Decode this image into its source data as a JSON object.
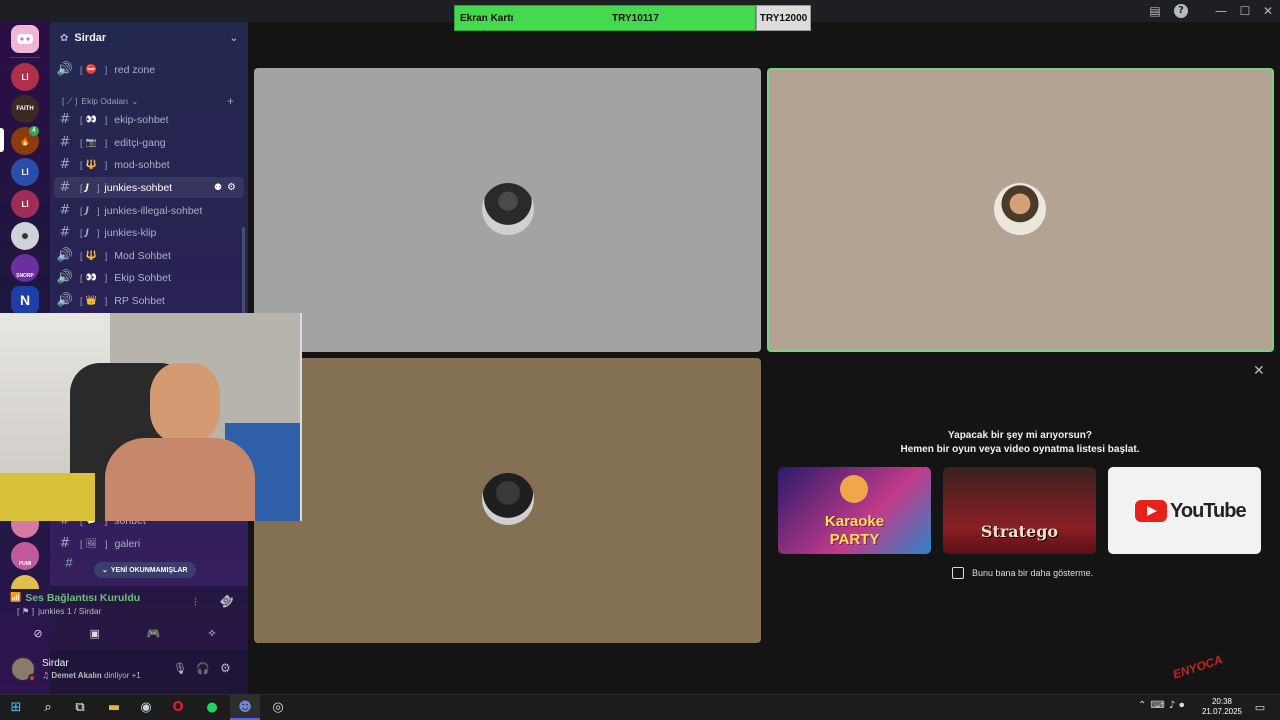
{
  "window": {
    "inbox_icon": "inbox-icon",
    "help_icon": "help-icon",
    "minimize_glyph": "—",
    "maximize_glyph": "☐",
    "close_glyph": "✕"
  },
  "donation": {
    "label": "Ekran Kartı",
    "current": "TRY10117",
    "goal": "TRY12000",
    "progress": 0.843,
    "color": "#45d94f"
  },
  "rail": {
    "servers": [
      {
        "name": "discord-home",
        "text": "",
        "bg": "#5865f2"
      },
      {
        "name": "server-li-1",
        "text": "Lİ",
        "bg": "#b0304a"
      },
      {
        "name": "server-faith",
        "text": "FAITH",
        "bg": "#3a2a22"
      },
      {
        "name": "server-fire",
        "text": "",
        "bg": "#8a3c10",
        "badge": "4"
      },
      {
        "name": "server-li-2",
        "text": "Lİ",
        "bg": "#2a4da8"
      },
      {
        "name": "server-li-3",
        "text": "Lİ",
        "bg": "#a02d55"
      },
      {
        "name": "server-wolf",
        "text": "",
        "bg": "#cfd2d8"
      },
      {
        "name": "server-snorp",
        "text": "SNORP",
        "bg": "#6a2fa0"
      },
      {
        "name": "server-n",
        "text": "N",
        "bg": "#1f3da6"
      },
      {
        "name": "server-pink",
        "text": "",
        "bg": "#d67aa2"
      },
      {
        "name": "server-purple",
        "text": "",
        "bg": "#8a4ab0"
      },
      {
        "name": "server-pumi",
        "text": "PUMI",
        "bg": "#c05a9a"
      }
    ]
  },
  "sidebar": {
    "server_name": "Sirdar",
    "category": "Ekip Odaları",
    "channels": [
      {
        "label": "red zone",
        "emoji": "⛔",
        "type": "voice"
      },
      {
        "label": "ekip-sohbet",
        "emoji": "👀",
        "type": "text"
      },
      {
        "label": "editçi-gang",
        "emoji": "📷",
        "type": "text"
      },
      {
        "label": "mod-sohbet",
        "emoji": "🔱",
        "type": "text"
      },
      {
        "label": "junkies-sohbet",
        "emoji": "J",
        "type": "text",
        "active": true
      },
      {
        "label": "junkies-illegal-sohbet",
        "emoji": "J",
        "type": "text"
      },
      {
        "label": "junkies-klip",
        "emoji": "J",
        "type": "text"
      },
      {
        "label": "Mod Sohbet",
        "emoji": "🔱",
        "type": "voice"
      },
      {
        "label": "Ekip Sohbet",
        "emoji": "👀",
        "type": "voice"
      },
      {
        "label": "RP Sohbet",
        "emoji": "👑",
        "type": "voice"
      },
      {
        "label": "sohbet",
        "emoji": "💬",
        "type": "text"
      },
      {
        "label": "galeri",
        "emoji": "🖼",
        "type": "text"
      }
    ],
    "unread_pill": "YENİ OKUNMAMIŞLAR",
    "voice": {
      "status": "Ses Bağlantısı Kuruldu",
      "channel": "junkies 1 / Sirdar"
    },
    "user": {
      "name": "Sirdar",
      "listening_name": "Demet Akalın",
      "listening_suffix": " dinliyor +1"
    }
  },
  "activity": {
    "title": "Yapacak bir şey mi arıyorsun?",
    "subtitle": "Hemen bir oyun veya video oynatma listesi başlat.",
    "cards": [
      {
        "name": "karaoke",
        "line1": "Karaoke",
        "line2": "PARTY"
      },
      {
        "name": "stratego",
        "line1": "Stratego"
      },
      {
        "name": "youtube",
        "line1": "YouTube"
      }
    ],
    "checkbox_label": "Bunu bana bir daha gösterme."
  },
  "tiles": {
    "tile1_bg": "#a3a3a3",
    "tile2_bg": "#b3a392",
    "tile3_bg": "#847154",
    "tile2_border": "#7ad082"
  },
  "taskbar": {
    "time": "20:38",
    "date": "21.07.2025"
  },
  "overlay_logo": "ENYOCA"
}
